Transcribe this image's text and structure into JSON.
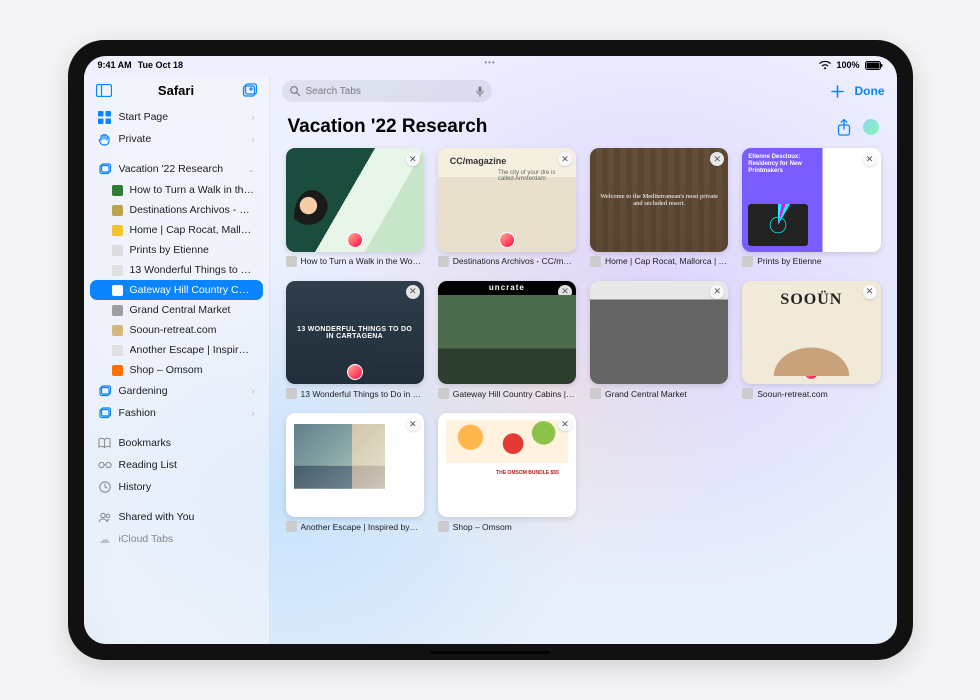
{
  "status": {
    "time": "9:41 AM",
    "date": "Tue Oct 18",
    "battery": "100%"
  },
  "sidebar": {
    "title": "Safari",
    "items": [
      {
        "id": "start-page",
        "label": "Start Page",
        "icon": "grid-icon",
        "chev": true
      },
      {
        "id": "private",
        "label": "Private",
        "icon": "hand-icon",
        "chev": true
      }
    ],
    "tab_group": {
      "label": "Vacation '22 Research",
      "children": [
        {
          "id": "walk",
          "label": "How to Turn a Walk in the …"
        },
        {
          "id": "cc",
          "label": "Destinations Archivos - CC…"
        },
        {
          "id": "cap",
          "label": "Home | Cap Rocat, Mallorc…"
        },
        {
          "id": "prints",
          "label": "Prints by Etienne"
        },
        {
          "id": "13",
          "label": "13 Wonderful Things to Do…"
        },
        {
          "id": "gateway",
          "label": "Gateway Hill Country Cabi…",
          "selected": true
        },
        {
          "id": "gcm",
          "label": "Grand Central Market"
        },
        {
          "id": "sooun",
          "label": "Sooun-retreat.com"
        },
        {
          "id": "another",
          "label": "Another Escape | Inspired…"
        },
        {
          "id": "omsom",
          "label": "Shop – Omsom"
        }
      ]
    },
    "other_groups": [
      {
        "id": "gardening",
        "label": "Gardening"
      },
      {
        "id": "fashion",
        "label": "Fashion"
      }
    ],
    "library": [
      {
        "id": "bookmarks",
        "label": "Bookmarks",
        "icon": "book-icon"
      },
      {
        "id": "reading",
        "label": "Reading List",
        "icon": "glasses-icon"
      },
      {
        "id": "history",
        "label": "History",
        "icon": "clock-icon"
      }
    ],
    "footer": [
      {
        "id": "shared",
        "label": "Shared with You",
        "icon": "people-icon"
      },
      {
        "id": "icloud",
        "label": "iCloud Tabs",
        "icon": "cloud-icon"
      }
    ]
  },
  "toolbar": {
    "search_placeholder": "Search Tabs",
    "done": "Done"
  },
  "group": {
    "title": "Vacation '22 Research"
  },
  "tabs": [
    {
      "caption": "How to Turn a Walk in the Wo…",
      "thumb": "t1",
      "avatar": true
    },
    {
      "caption": "Destinations Archivos - CC/m…",
      "thumb": "t2",
      "avatar": true
    },
    {
      "caption": "Home | Cap Rocat, Mallorca | …",
      "thumb": "t3",
      "avatar": false
    },
    {
      "caption": "Prints by Etienne",
      "thumb": "t4",
      "avatar": false
    },
    {
      "caption": "13 Wonderful Things to Do in …",
      "thumb": "t5",
      "avatar": true
    },
    {
      "caption": "Gateway Hill Country Cabins |…",
      "thumb": "t6",
      "avatar": false
    },
    {
      "caption": "Grand Central Market",
      "thumb": "t7",
      "avatar": false
    },
    {
      "caption": "Sooun-retreat.com",
      "thumb": "t8",
      "avatar": true
    },
    {
      "caption": "Another Escape | Inspired by…",
      "thumb": "t9",
      "avatar": false
    },
    {
      "caption": "Shop – Omsom",
      "thumb": "t10",
      "avatar": false
    }
  ]
}
